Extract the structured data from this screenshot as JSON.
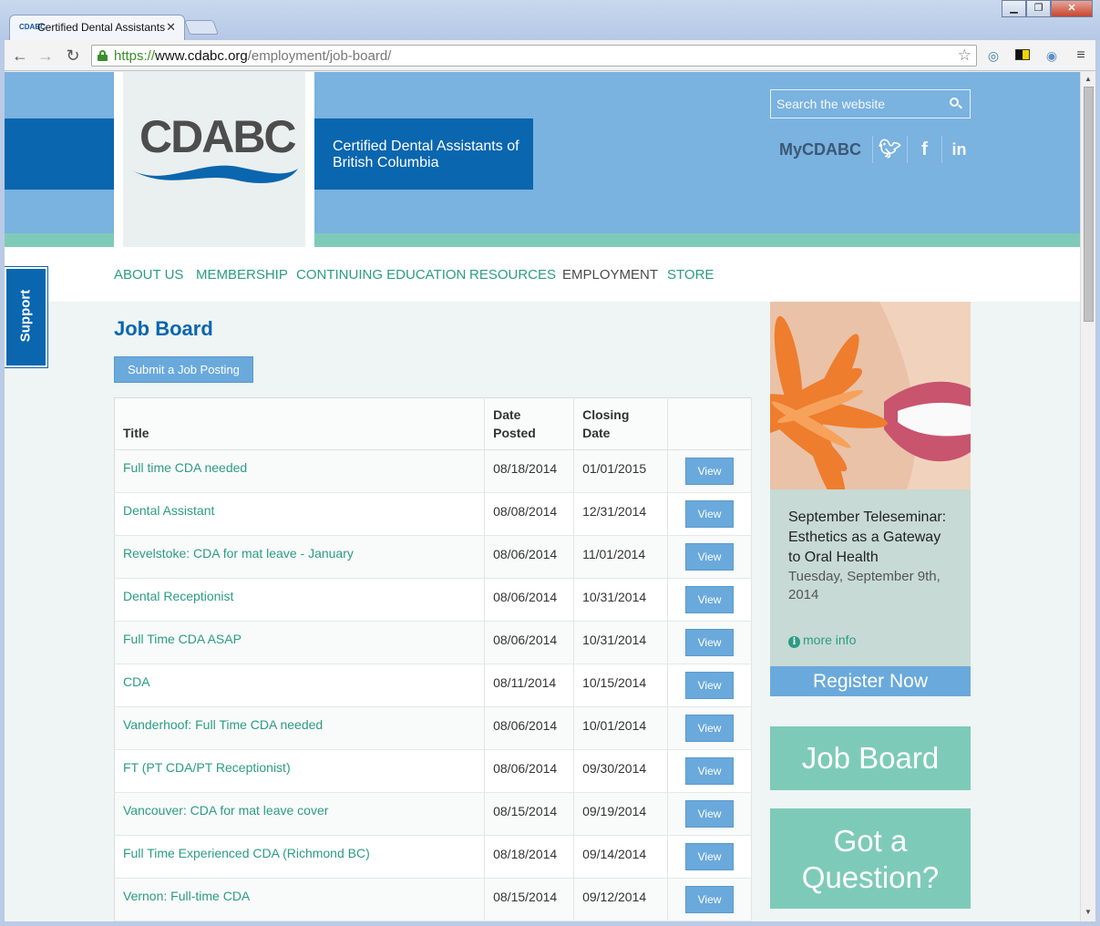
{
  "browser": {
    "tab_title": "Certified Dental Assistants",
    "tab_favicon_text": "CDABC",
    "url_scheme": "https://",
    "url_host": "www.cdabc.org",
    "url_path": "/employment/job-board/"
  },
  "header": {
    "logo_text": "CDABC",
    "org_name": "Certified Dental Assistants of British Columbia",
    "search_placeholder": "Search the website",
    "member_link": "MyCDABC",
    "social": [
      "twitter-icon",
      "facebook-icon",
      "linkedin-icon"
    ]
  },
  "nav": {
    "items": [
      {
        "label": "ABOUT US"
      },
      {
        "label": "MEMBERSHIP"
      },
      {
        "label": "CONTINUING EDUCATION"
      },
      {
        "label": "RESOURCES"
      },
      {
        "label": "EMPLOYMENT",
        "active": true
      },
      {
        "label": "STORE"
      }
    ]
  },
  "support_tab": "Support",
  "main": {
    "page_title": "Job Board",
    "submit_button": "Submit a Job Posting",
    "table": {
      "columns": [
        "Title",
        "Date Posted",
        "Closing Date",
        ""
      ],
      "view_label": "View",
      "rows": [
        {
          "title": "Full time CDA needed",
          "posted": "08/18/2014",
          "closing": "01/01/2015"
        },
        {
          "title": "Dental Assistant",
          "posted": "08/08/2014",
          "closing": "12/31/2014"
        },
        {
          "title": "Revelstoke: CDA for mat leave - January",
          "posted": "08/06/2014",
          "closing": "11/01/2014"
        },
        {
          "title": "Dental Receptionist",
          "posted": "08/06/2014",
          "closing": "10/31/2014"
        },
        {
          "title": "Full Time CDA ASAP",
          "posted": "08/06/2014",
          "closing": "10/31/2014"
        },
        {
          "title": "CDA",
          "posted": "08/11/2014",
          "closing": "10/15/2014"
        },
        {
          "title": "Vanderhoof: Full Time CDA needed",
          "posted": "08/06/2014",
          "closing": "10/01/2014"
        },
        {
          "title": "FT (PT CDA/PT Receptionist)",
          "posted": "08/06/2014",
          "closing": "09/30/2014"
        },
        {
          "title": "Vancouver: CDA for mat leave cover",
          "posted": "08/15/2014",
          "closing": "09/19/2014"
        },
        {
          "title": "Full Time Experienced CDA (Richmond BC)",
          "posted": "08/18/2014",
          "closing": "09/14/2014"
        },
        {
          "title": "Vernon: Full-time CDA",
          "posted": "08/15/2014",
          "closing": "09/12/2014"
        }
      ]
    }
  },
  "sidebar": {
    "promo_title": "September Teleseminar: Esthetics as a Gateway to Oral Health",
    "promo_date": "Tuesday, September 9th, 2014",
    "more_info": "more info",
    "register": "Register Now",
    "job_board_tile": "Job Board",
    "question_tile": "Got a Question?"
  },
  "colors": {
    "brand_blue": "#0a66ae",
    "header_blue": "#7ab2e0",
    "teal": "#7ecab8",
    "link_green": "#2b9c83",
    "button_blue": "#6aa9dc"
  }
}
